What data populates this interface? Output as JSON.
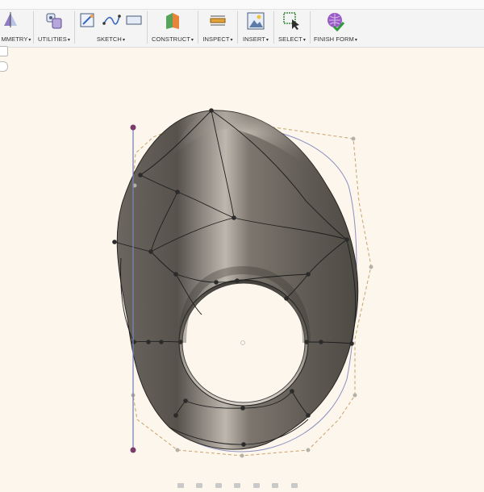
{
  "toolbar": {
    "groups": [
      {
        "label": "MMETRY",
        "icon": "symmetry-icon"
      },
      {
        "label": "UTILITIES",
        "icon": "utilities-icon"
      },
      {
        "label": "SKETCH",
        "icon": "sketch-icon"
      },
      {
        "label": "CONSTRUCT",
        "icon": "construct-icon"
      },
      {
        "label": "INSPECT",
        "icon": "inspect-icon"
      },
      {
        "label": "INSERT",
        "icon": "insert-icon"
      },
      {
        "label": "SELECT",
        "icon": "select-icon"
      },
      {
        "label": "FINISH FORM",
        "icon": "finish-form-icon"
      }
    ],
    "dropdown_caret": "▾"
  },
  "colors": {
    "canvas_background": "#fdf6ec",
    "surface_dark": "#5e5a55",
    "surface_light": "#a29c94",
    "edge": "#1e1e1e",
    "control_frame": "#c9a36a",
    "outline_curve": "#8a8fc0",
    "selected_point": "#7a3b6a"
  }
}
